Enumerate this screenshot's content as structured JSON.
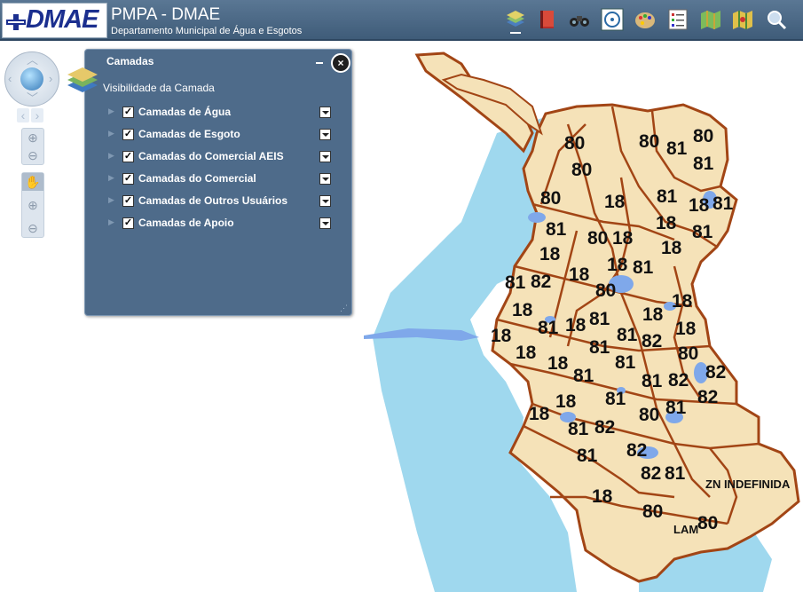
{
  "header": {
    "logo_text": "DMAE",
    "title": "PMPA - DMAE",
    "subtitle": "Departamento Municipal de Água e Esgotos"
  },
  "toolbar": {
    "tools": [
      "layers-icon",
      "book-icon",
      "binoculars-icon",
      "target-icon",
      "palette-icon",
      "list-icon",
      "map-icon",
      "map-pin-icon",
      "search-icon"
    ]
  },
  "layer_panel": {
    "title": "Camadas",
    "visibility_label": "Visibilidade da Camada",
    "layers": [
      {
        "label": "Camadas de Água",
        "checked": true
      },
      {
        "label": "Camadas de Esgoto",
        "checked": true
      },
      {
        "label": "Camadas do Comercial AEIS",
        "checked": true
      },
      {
        "label": "Camadas do Comercial",
        "checked": true
      },
      {
        "label": "Camadas de Outros Usuários",
        "checked": true
      },
      {
        "label": "Camadas de Apoio",
        "checked": true
      }
    ]
  },
  "map": {
    "colors": {
      "land": "#f5e2b8",
      "water": "#9fd8ee",
      "district_border": "#a24515",
      "pond": "#7fa8ea"
    },
    "zone_labels": [
      "80",
      "80",
      "81",
      "80",
      "80",
      "81",
      "80",
      "18",
      "81",
      "18",
      "81",
      "81",
      "18",
      "80",
      "18",
      "18",
      "81",
      "18",
      "18",
      "81",
      "18",
      "81",
      "80",
      "82",
      "18",
      "18",
      "18",
      "81",
      "18",
      "81",
      "81",
      "81",
      "82",
      "18",
      "18",
      "18",
      "81",
      "80",
      "18",
      "81",
      "81",
      "82",
      "81",
      "82",
      "18",
      "18",
      "80",
      "81",
      "81",
      "82",
      "82",
      "81",
      "82",
      "81",
      "18",
      "82",
      "80"
    ],
    "zone_names": [
      "ZN INDEFINIDA",
      "LAM"
    ]
  },
  "colors": {
    "header_bg": "#4a6785",
    "panel_bg": "#4e6b8a"
  }
}
